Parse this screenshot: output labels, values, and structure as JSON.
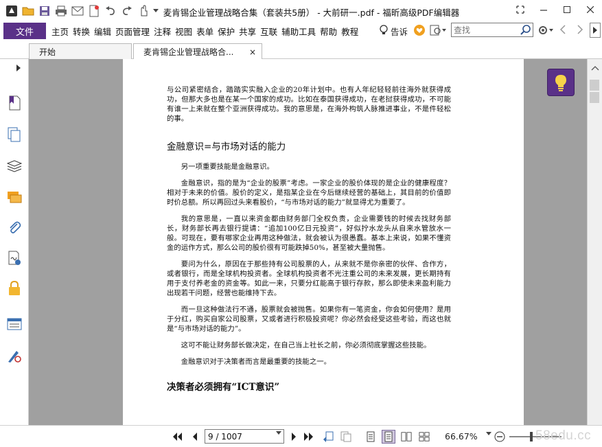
{
  "window": {
    "title": "麦肯锡企业管理战略合集（套装共5册） - 大前研一.pdf - 福昕高级PDF编辑器"
  },
  "menu": {
    "file_label": "文件",
    "items": [
      "主页",
      "转换",
      "编辑",
      "页面管理",
      "注释",
      "视图",
      "表单",
      "保护",
      "共享",
      "互联",
      "辅助工具",
      "帮助",
      "教程"
    ],
    "tell_me": "告诉",
    "search_placeholder": "查找"
  },
  "tabs": {
    "home": "开始",
    "doc": "麦肯锡企业管理战略合...",
    "close": "×"
  },
  "page": {
    "p1": "与公司紧密结合，踏踏实实融入企业的20年计划中。也有人年纪轻轻前往海外就获得成功，但那大多也是在某一个国家的成功。比如在泰国获得成功，在老挝获得成功，不可能有谁一上来就在整个亚洲获得成功。我的意思是，在海外构筑人脉推进事业，不是件轻松的事。",
    "h1": "金融意识=与市场对话的能力",
    "p2": "另一项重要技能是金融意识。",
    "p3": "金融意识，指的是为“企业的股票”考虑。一家企业的股价体现的是企业的健康程度？相对于未来的价值。股价的定义，是指某企业在今后继续经营的基础上，其目前的价值即时价总额。所以再回过头来看股价，“与市场对话的能力”就显得尤为重要了。",
    "p4": "我的意思是，一直以来资金都由财务部门全权负责，企业需要钱的时候去找财务部长，财务部长再去银行提请：“追加100亿日元投资”，好似拧水龙头从自来水管放水一般。可现在，要有哪家企业再用这种做法，就会被认为很愚蠢。基本上来说，如果不懂资金的运作方式，那么公司的股价很有可能跌掉50%，甚至被大量抛售。",
    "p5": "要问为什么，原因在于那些持有公司股票的人，从来就不是你亲密的伙伴、合作方，或者银行，而是全球机构投资者。全球机构投资者不光注重公司的未来发展，更长期持有用于支付养老金的资金等。如此一来，只要分红能高于银行存款，那么即使未来盈利能力出现若干问题，经营也能维持下去。",
    "p6": "而一旦这种做法行不通，股票就会被抛售。如果你有一笔资金，你会如何使用？是用于分红，购买自家公司股票，又或者进行积极投资呢？你必然会经受这些考验，而这也就是“与市场对话的能力”。",
    "p7": "这可不能让财务部长做决定，在自己当上社长之前，你必须彻底掌握这些技能。",
    "p8": "金融意识对于决策者而言是最重要的技能之一。",
    "h2": "决策者必须拥有“ICT意识”"
  },
  "status": {
    "page_value": "9 / 1007",
    "zoom": "66.67%",
    "watermark": "58edu.cc"
  },
  "colors": {
    "accent": "#5a3188",
    "doc_background": "#a0a0a0"
  }
}
